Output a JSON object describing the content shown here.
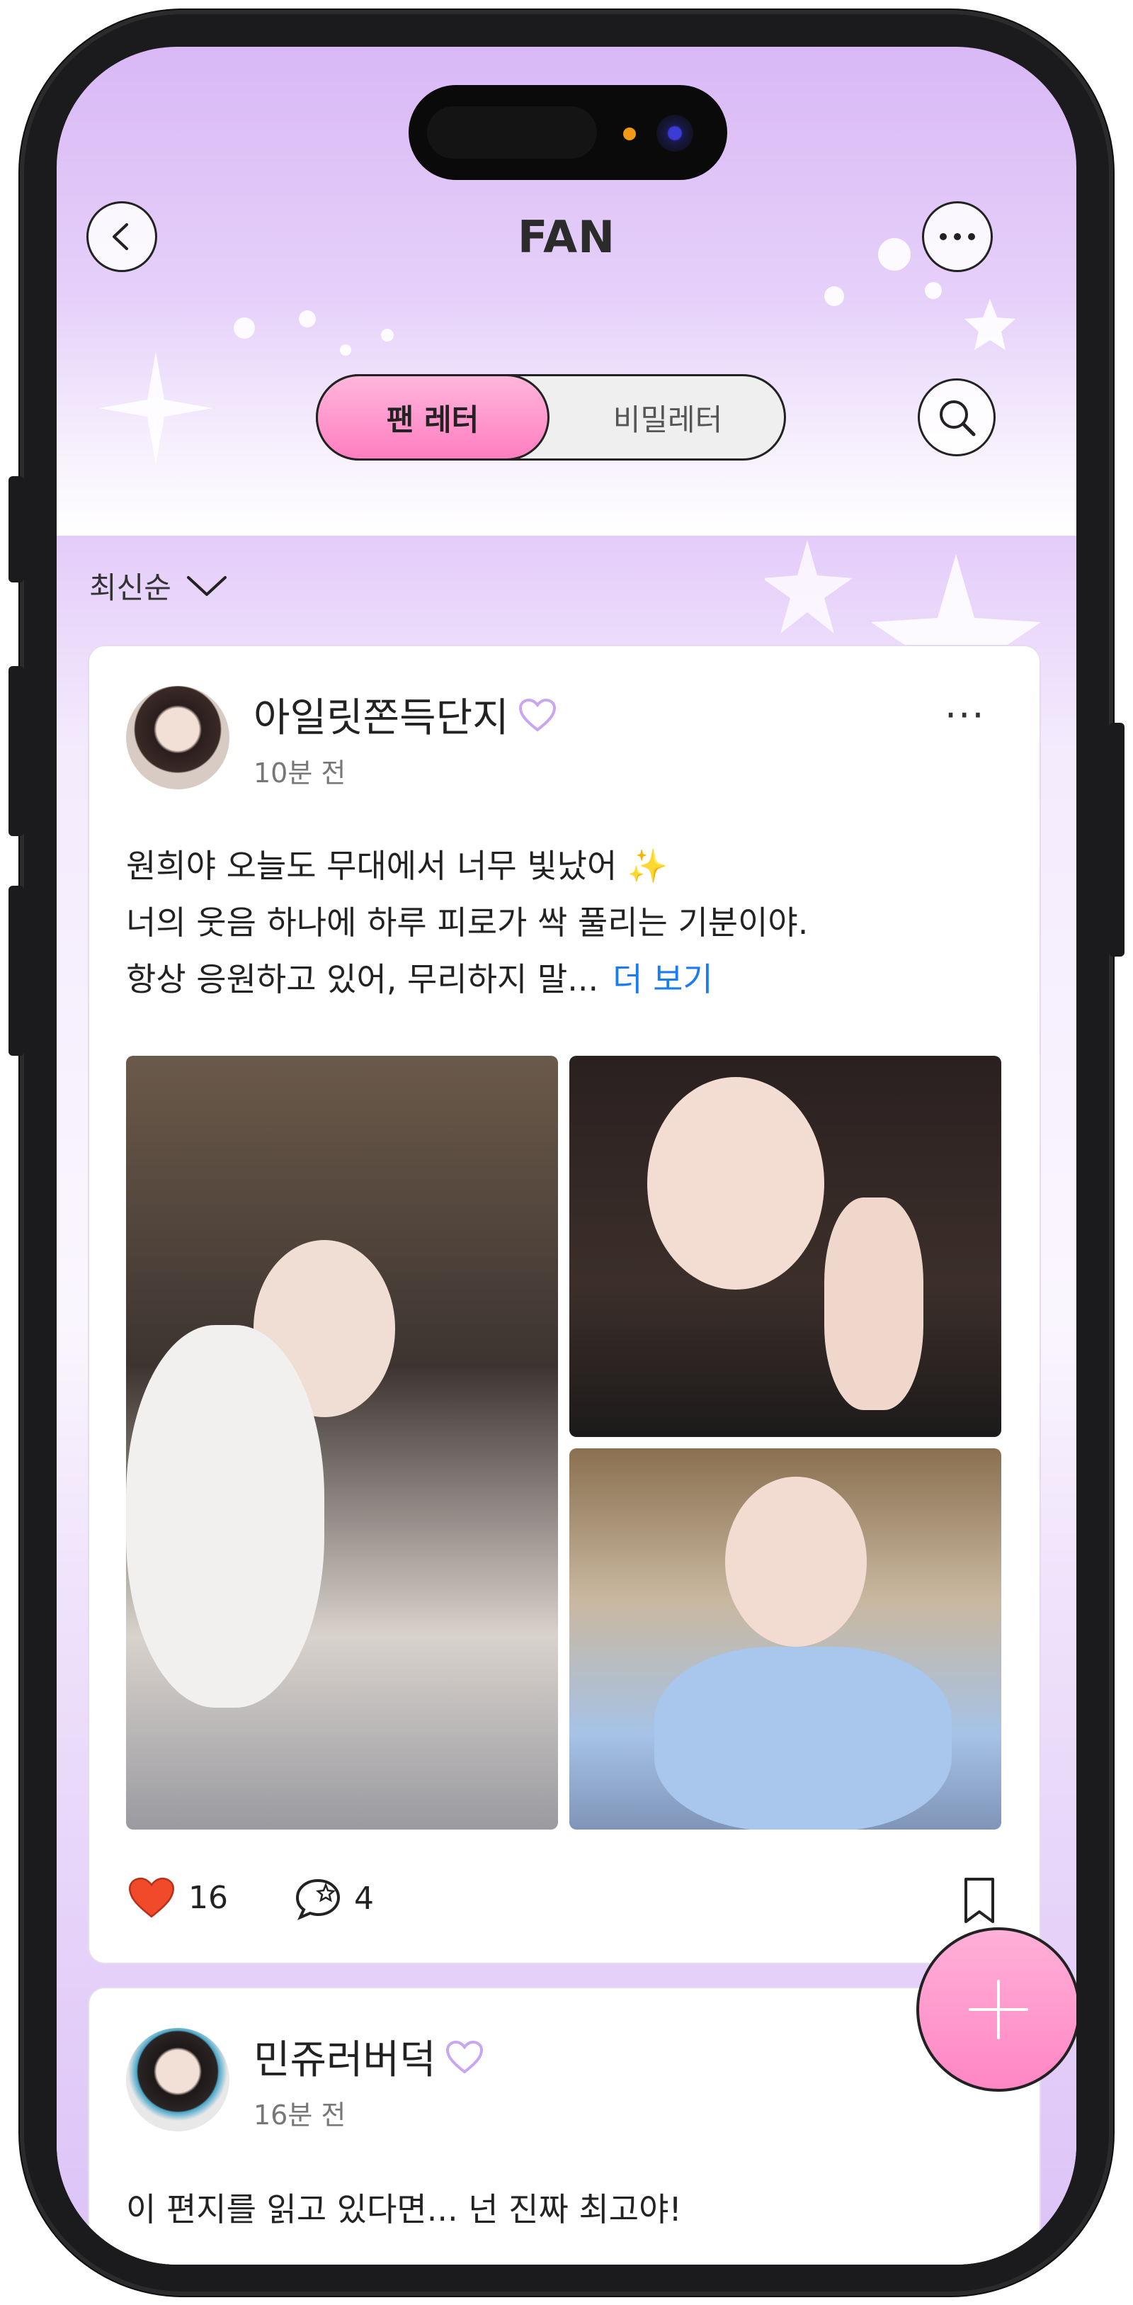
{
  "header": {
    "title": "FAN",
    "back_icon": "chevron-left-icon",
    "more_icon": "ellipsis-icon",
    "search_icon": "search-icon"
  },
  "tabs": {
    "active": "팬 레터",
    "inactive": "비밀레터"
  },
  "sort": {
    "label": "최신순",
    "icon": "chevron-down-icon"
  },
  "posts": [
    {
      "username": "아일릿쫀득단지",
      "time": "10분 전",
      "lines": [
        "원희야 오늘도 무대에서 너무 빛났어 ✨",
        "너의 웃음 하나에 하루 피로가 싹 풀리는 기분이야.",
        "항상 응원하고 있어, 무리하지 말..."
      ],
      "more_label": "더 보기",
      "likes": "16",
      "comments": "4"
    },
    {
      "username": "민쥬러버덕",
      "time": "16분 전",
      "lines": [
        "이 편지를 읽고 있다면... 넌 진짜 최고야!"
      ]
    }
  ],
  "colors": {
    "accent_pink": "#ff86c4",
    "lavender": "#d9b8f5",
    "heart": "#f04a2a",
    "link": "#1a7cf0"
  }
}
